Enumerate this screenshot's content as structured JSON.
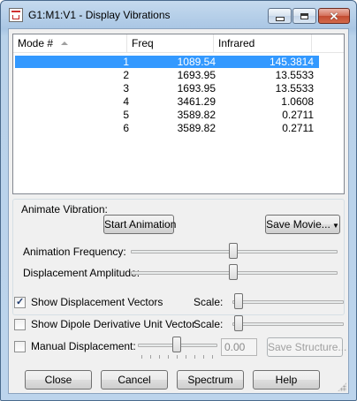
{
  "window": {
    "title": "G1:M1:V1 - Display Vibrations"
  },
  "table": {
    "columns": [
      "Mode #",
      "Freq",
      "Infrared"
    ],
    "rows": [
      {
        "mode": "1",
        "freq": "1089.54",
        "ir": "145.3814",
        "selected": true
      },
      {
        "mode": "2",
        "freq": "1693.95",
        "ir": "13.5533"
      },
      {
        "mode": "3",
        "freq": "1693.95",
        "ir": "13.5533"
      },
      {
        "mode": "4",
        "freq": "3461.29",
        "ir": "1.0608"
      },
      {
        "mode": "5",
        "freq": "3589.82",
        "ir": "0.2711"
      },
      {
        "mode": "6",
        "freq": "3589.82",
        "ir": "0.2711"
      }
    ]
  },
  "animate": {
    "group_label": "Animate Vibration:",
    "start_label": "Start Animation",
    "save_movie_label": "Save Movie...",
    "frequency_label": "Animation Frequency:",
    "frequency_level": 0.5,
    "amplitude_label": "Displacement Amplitude:",
    "amplitude_level": 0.5
  },
  "options": {
    "show_displacement_label": "Show Displacement Vectors",
    "show_displacement_checked": true,
    "show_dipole_label": "Show Dipole Derivative Unit Vector",
    "show_dipole_checked": false,
    "manual_label": "Manual Displacement:",
    "manual_checked": false,
    "manual_level": 0.5,
    "manual_value": "0.00",
    "save_structure_label": "Save Structure...",
    "scale_label": "Scale:",
    "displacement_scale_level": 0.0,
    "dipole_scale_level": 0.0
  },
  "footer": {
    "close_label": "Close",
    "cancel_label": "Cancel",
    "spectrum_label": "Spectrum",
    "help_label": "Help"
  },
  "colors": {
    "selection": "#3399ff",
    "title_gradient": "#a9c6e4",
    "close_button": "#c24a30"
  }
}
